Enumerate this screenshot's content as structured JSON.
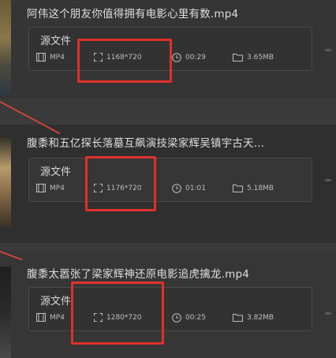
{
  "items": [
    {
      "title": "阿伟这个朋友你值得拥有电影心里有数.mp4",
      "source_label": "源文件",
      "format": "MP4",
      "resolution": "1168*720",
      "duration": "00:29",
      "size": "3.65MB"
    },
    {
      "title": "腹黍和五亿探长落墓互飙演技梁家辉吴镇宇古天...",
      "source_label": "源文件",
      "format": "MP4",
      "resolution": "1176*720",
      "duration": "01:01",
      "size": "5.18MB"
    },
    {
      "title": "腹黍太嚣张了梁家辉神还原电影追虎擒龙.mp4",
      "source_label": "源文件",
      "format": "MP4",
      "resolution": "1280*720",
      "duration": "00:25",
      "size": "3.82MB"
    }
  ],
  "colors": {
    "background": "#3a3a3a",
    "row_alt": "#2e2e2e",
    "highlight_box": "#e0302a"
  },
  "icons": {
    "format": "film-icon",
    "resolution": "expand-icon",
    "duration": "clock-icon",
    "size": "folder-icon"
  }
}
